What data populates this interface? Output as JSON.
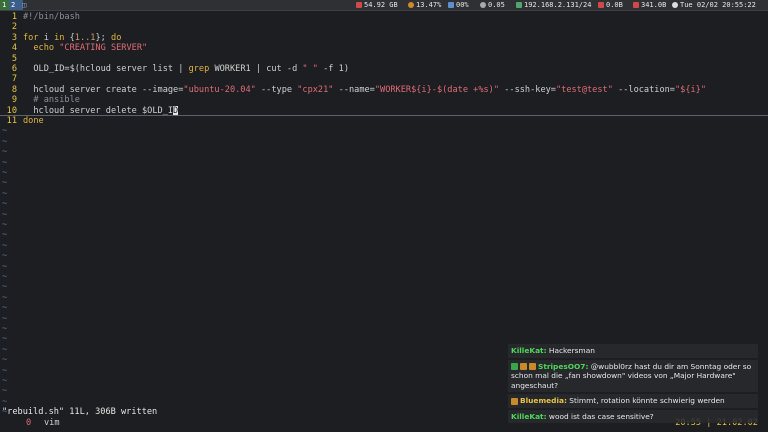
{
  "topbar": {
    "workspaces": [
      "1",
      "2",
      ""
    ],
    "disk": "54.92 GB",
    "cpu": "13.47%",
    "mem": "00%",
    "load": "0.05",
    "ip": "192.168.2.131/24",
    "net_up": "0.0B",
    "net_down": "341.0B",
    "datetime": "Tue 02/02 20:55:22",
    "colors": {
      "workspace_active": "#3a6e3a",
      "workspace_focus": "#3b5f8a"
    }
  },
  "editor": {
    "lines": [
      {
        "n": "1",
        "segments": [
          {
            "t": "#!/bin/bash",
            "c": "cmt"
          }
        ]
      },
      {
        "n": "2",
        "segments": []
      },
      {
        "n": "3",
        "segments": [
          {
            "t": "for",
            "c": "kw"
          },
          {
            "t": " i ",
            "c": "var"
          },
          {
            "t": "in",
            "c": "kw"
          },
          {
            "t": " {",
            "c": "var"
          },
          {
            "t": "1..1",
            "c": "num"
          },
          {
            "t": "}; ",
            "c": "var"
          },
          {
            "t": "do",
            "c": "kw"
          }
        ]
      },
      {
        "n": "4",
        "segments": [
          {
            "t": "  echo ",
            "c": "kw"
          },
          {
            "t": "\"CREATING SERVER\"",
            "c": "str"
          }
        ]
      },
      {
        "n": "5",
        "segments": []
      },
      {
        "n": "6",
        "segments": [
          {
            "t": "  OLD_ID=$(hcloud server list | ",
            "c": "var"
          },
          {
            "t": "grep",
            "c": "kw"
          },
          {
            "t": " WORKER1 | cut -d ",
            "c": "var"
          },
          {
            "t": "\" \"",
            "c": "str"
          },
          {
            "t": " -f 1)",
            "c": "var"
          }
        ]
      },
      {
        "n": "7",
        "segments": []
      },
      {
        "n": "8",
        "segments": [
          {
            "t": "  hcloud server create --image=",
            "c": "var"
          },
          {
            "t": "\"ubuntu-20.04\"",
            "c": "str"
          },
          {
            "t": " --type ",
            "c": "var"
          },
          {
            "t": "\"cpx21\"",
            "c": "str"
          },
          {
            "t": " --name=",
            "c": "var"
          },
          {
            "t": "\"WORKER${i}-$(date +%s)\"",
            "c": "str"
          },
          {
            "t": " --ssh-key=",
            "c": "var"
          },
          {
            "t": "\"test@test\"",
            "c": "str"
          },
          {
            "t": " --location=",
            "c": "var"
          },
          {
            "t": "\"${i}\"",
            "c": "str"
          }
        ]
      },
      {
        "n": "9",
        "segments": [
          {
            "t": "  # ansible",
            "c": "cmt"
          }
        ]
      },
      {
        "n": "10",
        "segments": [
          {
            "t": "  hcloud server delete $OLD_I",
            "c": "var"
          },
          {
            "t": "D",
            "c": "cursor"
          }
        ]
      },
      {
        "n": "11",
        "segments": [
          {
            "t": "done",
            "c": "kw"
          }
        ]
      }
    ],
    "tilde": "~",
    "tilde_count": 28
  },
  "status": {
    "message": "\"rebuild.sh\" 11L, 306B written",
    "window_number": "0",
    "window_name": "vim",
    "clock": "20:55 | 21.02.02"
  },
  "chat": [
    {
      "user": "KilleKat",
      "user_color": "#4fd65a",
      "text": "Hackersman",
      "badges": []
    },
    {
      "user": "StripesOO7",
      "user_color": "#4fd65a",
      "text": "@wubbl0rz hast du dir am Sonntag oder so schon mal die „fan showdown\" videos von „Major Hardware\" angeschaut?",
      "badges": [
        "#3aa64a",
        "#c98a2c",
        "#c98a2c"
      ]
    },
    {
      "user": "Bluemedia",
      "user_color": "#e7c547",
      "text": "Stimmt, rotation könnte schwierig werden",
      "badges": [
        "#c98a2c"
      ]
    },
    {
      "user": "KilleKat",
      "user_color": "#4fd65a",
      "text": "wood ist das case sensitive?",
      "badges": []
    }
  ]
}
